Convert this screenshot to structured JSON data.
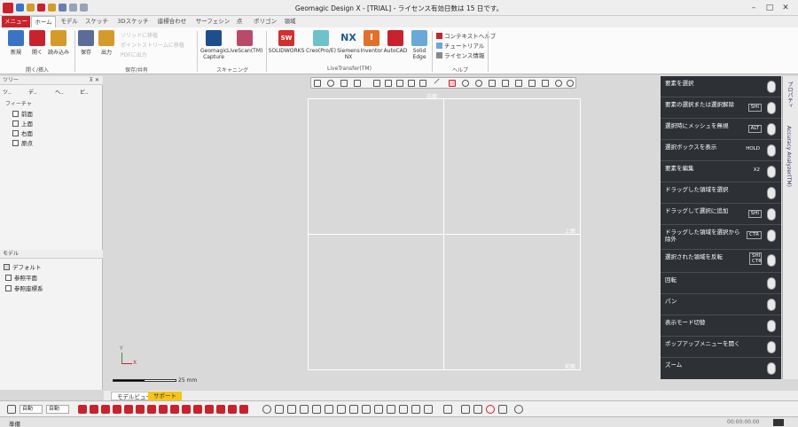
{
  "app": {
    "title": "Geomagic Design X - [TRIAL] - ライセンス有効日数は 15 日です。",
    "win_min": "–",
    "win_max": "□",
    "win_close": "✕"
  },
  "tabs": [
    "メニュー",
    "ホーム",
    "モデル",
    "スケッチ",
    "3Dスケッチ",
    "座標合わせ",
    "サーフェシング",
    "点",
    "ポリゴン",
    "領域"
  ],
  "ribbon": {
    "insert_group": {
      "label": "開く/挿入",
      "buttons": [
        "新規",
        "開く",
        "読み込み"
      ]
    },
    "save_group": {
      "label": "保存/共有",
      "buttons": [
        "保存",
        "出力"
      ],
      "disabled_items": [
        "ソリッドに移植",
        "ポイントストリームに移植",
        "PDFに出力"
      ]
    },
    "scan_group": {
      "label": "スキャニング",
      "buttons": [
        "Geomagic Capture",
        "LiveScan(TM)"
      ]
    },
    "transfer_group": {
      "label": "LiveTransfer(TM)",
      "buttons": [
        "SOLIDWORKS",
        "Creo(Pro/E)",
        "Siemens NX",
        "Inventor",
        "AutoCAD",
        "Solid Edge"
      ],
      "icon_labels": [
        "SW",
        "",
        "NX",
        "I",
        "",
        ""
      ]
    },
    "help_group": {
      "label": "ヘルプ",
      "items": [
        "コンテキストヘルプ",
        "チュートリアル",
        "ライセンス情報"
      ]
    }
  },
  "tree": {
    "title": "ツリー",
    "pin": "⊼ ✕",
    "tabs": [
      "ツ..",
      "デ..",
      "ヘ..",
      "ビ.."
    ],
    "feature_label": "フィーチャ",
    "features": [
      "前面",
      "上面",
      "右面",
      "原点"
    ],
    "model_title": "モデル",
    "model_items": [
      "デフォルト",
      "参照平面",
      "参照座標系"
    ]
  },
  "viewport": {
    "view_labels": {
      "top": "右面",
      "right_mid": "上面",
      "bottom_right": "前面"
    },
    "scale_label": "25 mm",
    "axis_y": "Y",
    "axis_x": "X"
  },
  "right_panel": {
    "rows": [
      {
        "label": "要素を選択",
        "key": ""
      },
      {
        "label": "要素の選択または選択解除",
        "key": "SHI"
      },
      {
        "label": "選択時にメッシュを無視",
        "key": "ALT"
      },
      {
        "label": "選択ボックスを表示",
        "key": "HOLD"
      },
      {
        "label": "要素を編集",
        "key": "X2"
      },
      {
        "label": "ドラッグした領域を選択",
        "key": ""
      },
      {
        "label": "ドラッグして選択に追加",
        "key": "SHI"
      },
      {
        "label": "ドラッグした領域を選択から除外",
        "key": "CTR"
      },
      {
        "label": "選択された領域を反転",
        "key": "SHI CTR"
      },
      {
        "label": "回転",
        "key": ""
      },
      {
        "label": "パン",
        "key": ""
      },
      {
        "label": "表示モード切替",
        "key": ""
      },
      {
        "label": "ポップアップメニューを開く",
        "key": ""
      },
      {
        "label": "ズーム",
        "key": ""
      }
    ]
  },
  "side_tabs": [
    "プロパティ",
    "Accuracy Analyzer(TM)"
  ],
  "bottom_tabs": [
    "モデルビュー",
    "サポート"
  ],
  "bottom_toolbar": {
    "combo1": "自動",
    "combo2": "自動"
  },
  "status": {
    "left": "準備",
    "time": "00:00:00.00"
  },
  "colors": {
    "brand_red": "#c8232c",
    "panel_dark": "#2d3035",
    "viewport_bg": "#d9d9d9",
    "support_tab": "#f5c518"
  }
}
